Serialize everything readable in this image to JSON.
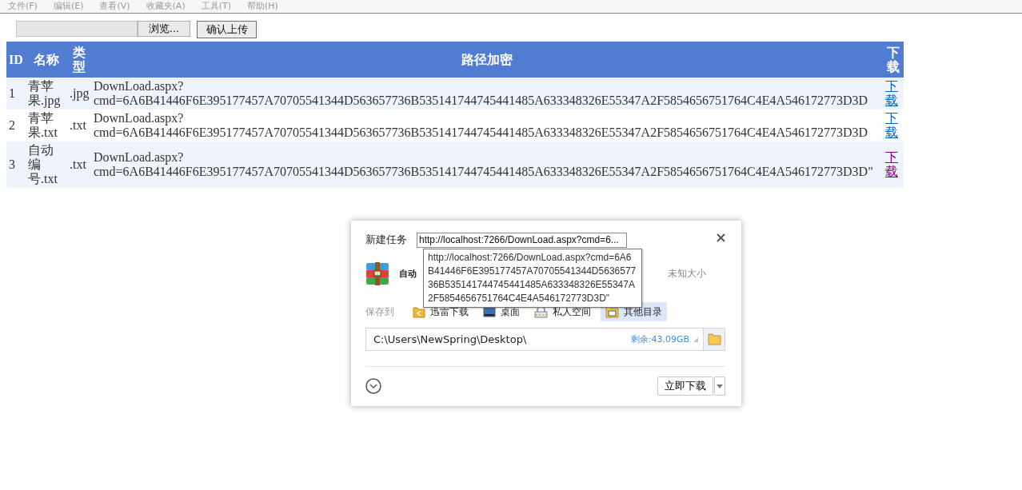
{
  "menu": [
    {
      "label": "文件(F)"
    },
    {
      "label": "编辑(E)"
    },
    {
      "label": "查看(V)"
    },
    {
      "label": "收藏夹(A)"
    },
    {
      "label": "工具(T)"
    },
    {
      "label": "帮助(H)"
    }
  ],
  "upload": {
    "browse_button": "浏览...",
    "submit_button": "确认上传"
  },
  "table": {
    "columns": [
      "ID",
      "名称",
      "类型",
      "路径加密",
      "下载"
    ],
    "rows": [
      {
        "id": "1",
        "name": "青苹果.jpg",
        "type": ".jpg",
        "path": "DownLoad.aspx?cmd=6A6B41446F6E395177457A70705541344D563657736B535141744745441485A633348326E55347A2F5854656751764C4E4A546172773D3D",
        "link": "下载",
        "visited": false
      },
      {
        "id": "2",
        "name": "青苹果.txt",
        "type": ".txt",
        "path": "DownLoad.aspx?cmd=6A6B41446F6E395177457A70705541344D563657736B535141744745441485A633348326E55347A2F5854656751764C4E4A546172773D3D",
        "link": "下载",
        "visited": false
      },
      {
        "id": "3",
        "name": "自动编号.txt",
        "type": ".txt",
        "path": "DownLoad.aspx?cmd=6A6B41446F6E395177457A70705541344D563657736B535141744745441485A633348326E55347A2F5854656751764C4E4A546172773D3D\"",
        "link": "下载",
        "visited": true
      }
    ]
  },
  "dialog": {
    "title": "新建任务",
    "url": "http://localhost:7266/DownLoad.aspx?cmd=6...",
    "tooltip": "http://localhost:7266/DownLoad.aspx?cmd=6A6B41446F6E395177457A70705541344D563657736B535141744745441485A633348326E55347A2F5854656751764C4E4A546172773D3D\"",
    "file_name": "自动",
    "file_size": "未知大小",
    "save_label": "保存到",
    "save_options": [
      {
        "label": "迅雷下载",
        "kind": "thunder",
        "selected": false
      },
      {
        "label": "桌面",
        "kind": "desktop",
        "selected": false
      },
      {
        "label": "私人空间",
        "kind": "private",
        "selected": false
      },
      {
        "label": "其他目录",
        "kind": "other",
        "selected": true
      }
    ],
    "path": "C:\\Users\\NewSpring\\Desktop\\",
    "free_space": "剩余:43.09GB",
    "download_button": "立即下载"
  }
}
